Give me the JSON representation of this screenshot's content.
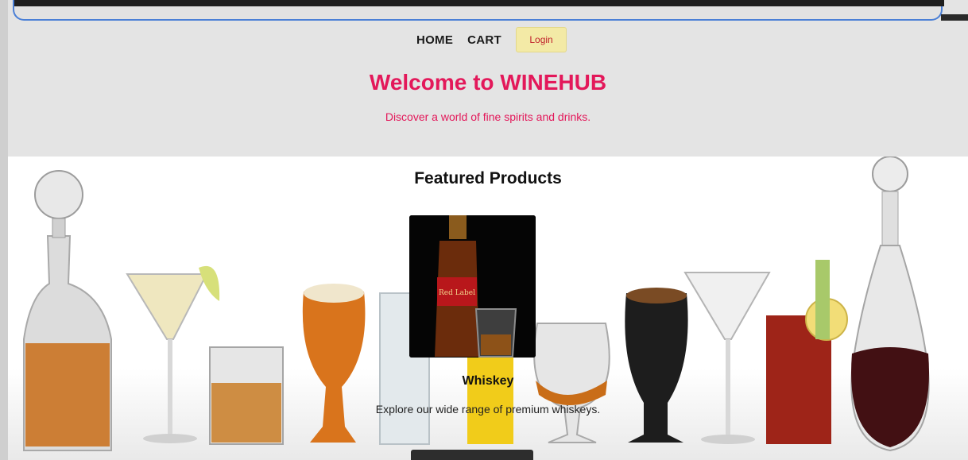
{
  "nav": {
    "home_label": "HOME",
    "cart_label": "CART",
    "login_label": "Login"
  },
  "hero": {
    "title": "Welcome to WINEHUB",
    "subtitle": "Discover a world of fine spirits and drinks."
  },
  "featured": {
    "title": "Featured Products",
    "products": [
      {
        "name": "Whiskey",
        "description": "Explore our wide range of premium whiskeys.",
        "image_label": "Red Label"
      }
    ]
  },
  "colors": {
    "accent": "#e3185a",
    "header_bg": "#e4e4e4",
    "login_bg": "#f3eaa6",
    "login_text": "#c01f2a"
  }
}
